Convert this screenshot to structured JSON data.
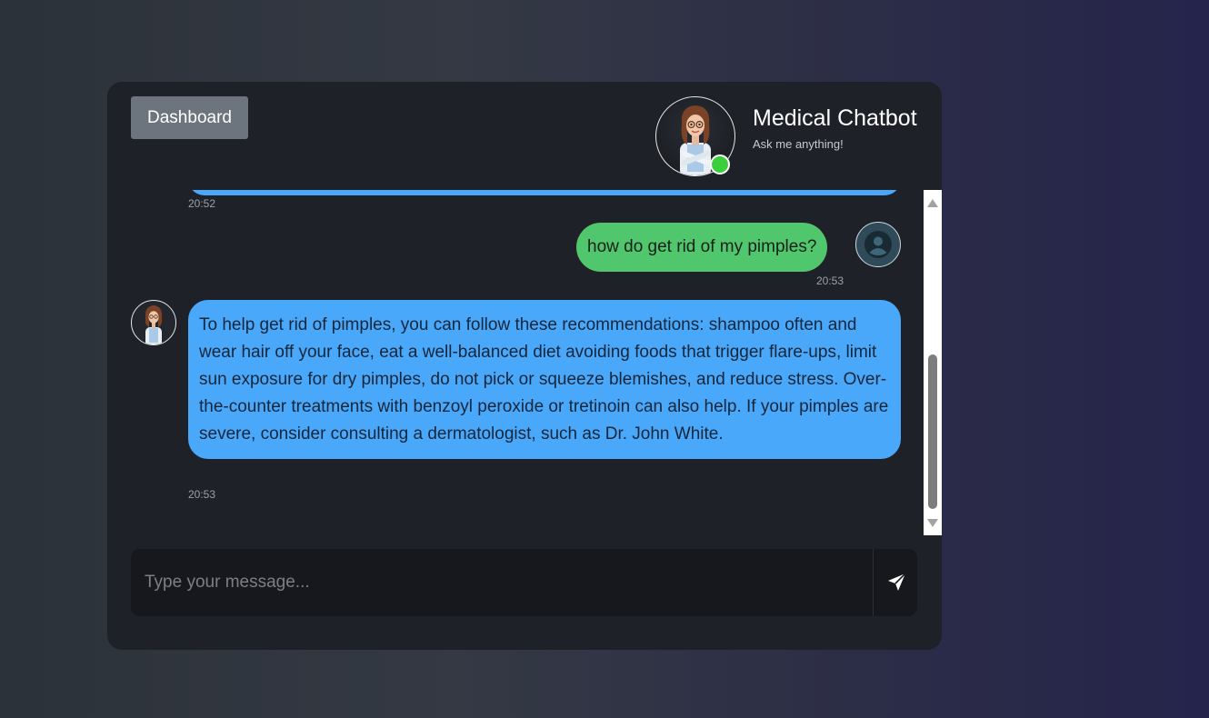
{
  "header": {
    "dashboard_label": "Dashboard",
    "title": "Medical Chatbot",
    "subtitle": "Ask me anything!",
    "status": "online",
    "status_color": "#3ccf3c"
  },
  "messages": [
    {
      "sender": "bot",
      "text": "",
      "time": "20:52"
    },
    {
      "sender": "user",
      "text": "how do get rid of my pimples?",
      "time": "20:53"
    },
    {
      "sender": "bot",
      "text": "To help get rid of pimples, you can follow these recommendations: shampoo often and wear hair off your face, eat a well-balanced diet avoiding foods that trigger flare-ups, limit sun exposure for dry pimples, do not pick or squeeze blemishes, and reduce stress. Over-the-counter treatments with benzoyl peroxide or tretinoin can also help. If your pimples are severe, consider consulting a dermatologist, such as Dr. John White.",
      "time": "20:53"
    }
  ],
  "composer": {
    "placeholder": "Type your message...",
    "value": "",
    "send_icon": "paper-plane-icon"
  },
  "colors": {
    "bot_bubble": "#4aa8fa",
    "user_bubble": "#50c66d",
    "dashboard_button": "#6c757d",
    "panel": "#1f2128"
  },
  "scroll": {
    "thumb_position": 0.85
  }
}
